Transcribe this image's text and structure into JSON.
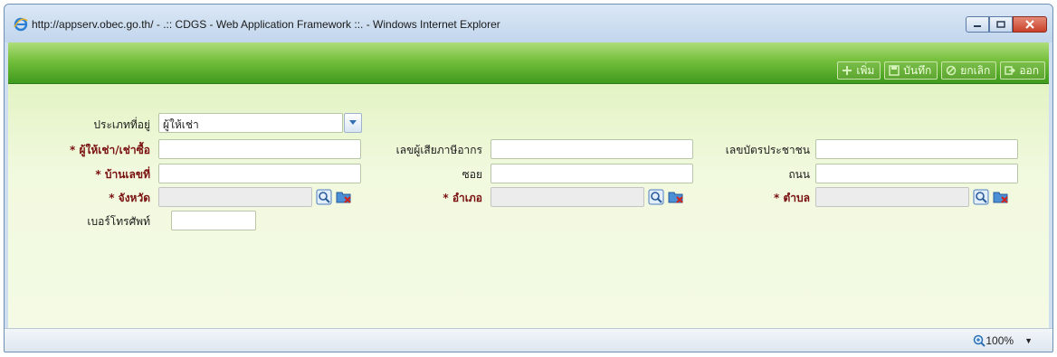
{
  "window": {
    "title": "http://appserv.obec.go.th/ - .:: CDGS - Web Application Framework ::. - Windows Internet Explorer"
  },
  "toolbar": {
    "buttons": [
      {
        "label": "เพิ่ม",
        "icon": "plus-icon"
      },
      {
        "label": "บันทึก",
        "icon": "save-icon"
      },
      {
        "label": "ยกเลิก",
        "icon": "cancel-icon"
      },
      {
        "label": "ออก",
        "icon": "exit-icon"
      }
    ]
  },
  "form": {
    "address_type": {
      "label": "ประเภทที่อยู่",
      "value": "ผู้ให้เช่า"
    },
    "lessor_name": {
      "label": "* ผู้ให้เช่า/เช่าซื้อ",
      "value": ""
    },
    "tax_id": {
      "label": "เลขผู้เสียภาษีอากร",
      "value": ""
    },
    "citizen_id": {
      "label": "เลขบัตรประชาชน",
      "value": ""
    },
    "house_no": {
      "label": "* บ้านเลขที่",
      "value": ""
    },
    "soi": {
      "label": "ซอย",
      "value": ""
    },
    "road": {
      "label": "ถนน",
      "value": ""
    },
    "province": {
      "label": "* จังหวัด",
      "value": ""
    },
    "district": {
      "label": "* อำเภอ",
      "value": ""
    },
    "subdistrict": {
      "label": "* ตำบล",
      "value": ""
    },
    "phone": {
      "label": "เบอร์โทรศัพท์",
      "value": ""
    }
  },
  "statusbar": {
    "zoom": "100%"
  }
}
